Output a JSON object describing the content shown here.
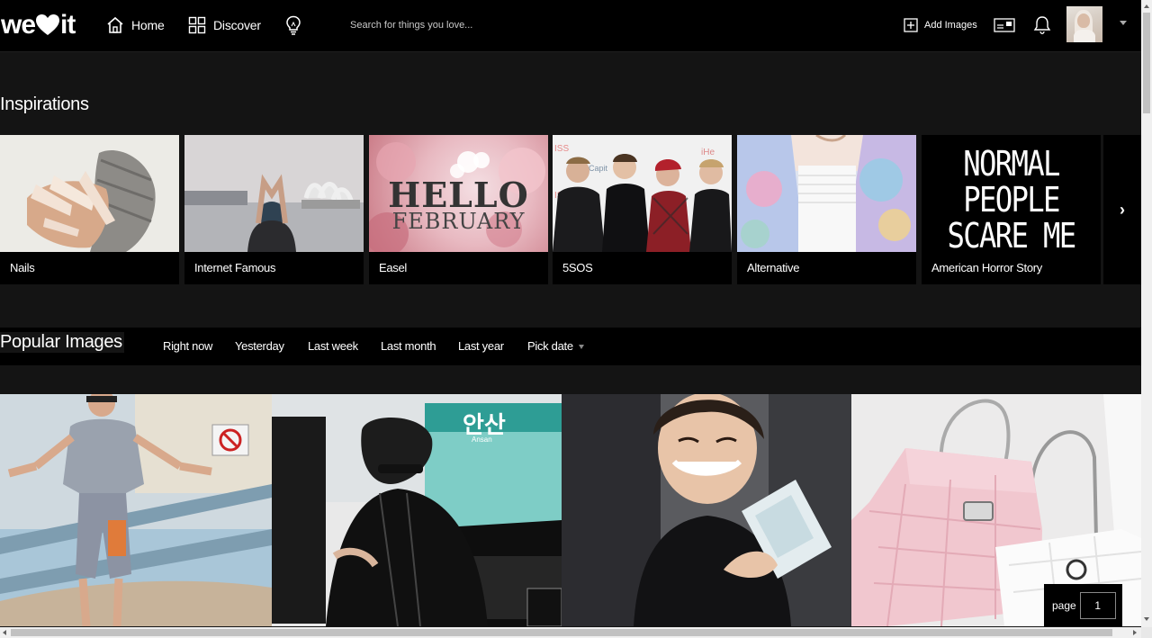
{
  "header": {
    "logo_left": "we",
    "logo_right": "it",
    "nav": [
      {
        "label": "Home",
        "icon": "home-icon"
      },
      {
        "label": "Discover",
        "icon": "grid-icon"
      },
      {
        "label": "",
        "icon": "lightbulb-icon"
      }
    ],
    "search_placeholder": "Search for things you love...",
    "add_images_label": "Add Images",
    "icons": [
      "plus-square-icon",
      "collections-icon",
      "bell-icon",
      "avatar",
      "chevron-down-icon"
    ]
  },
  "inspirations": {
    "title": "Inspirations",
    "cards": [
      {
        "label": "Nails"
      },
      {
        "label": "Internet Famous"
      },
      {
        "label": "Easel",
        "art_line1": "HELLO",
        "art_line2": "FEBRUARY"
      },
      {
        "label": "5SOS"
      },
      {
        "label": "Alternative"
      },
      {
        "label": "American Horror Story",
        "art_line1": "NORMAL",
        "art_line2": "PEOPLE",
        "art_line3": "SCARE ME"
      }
    ],
    "next_label": "›"
  },
  "popular": {
    "title": "Popular Images",
    "tabs": [
      "Right now",
      "Yesterday",
      "Last week",
      "Last month",
      "Last year",
      "Pick date"
    ],
    "grid_overlays": {
      "img2_sign": "안산",
      "img2_sign_sub": "Ansan"
    }
  },
  "pagination": {
    "label": "page",
    "value": "1"
  },
  "colors": {
    "background": "#141414",
    "header": "#000000",
    "text": "#ffffff"
  }
}
